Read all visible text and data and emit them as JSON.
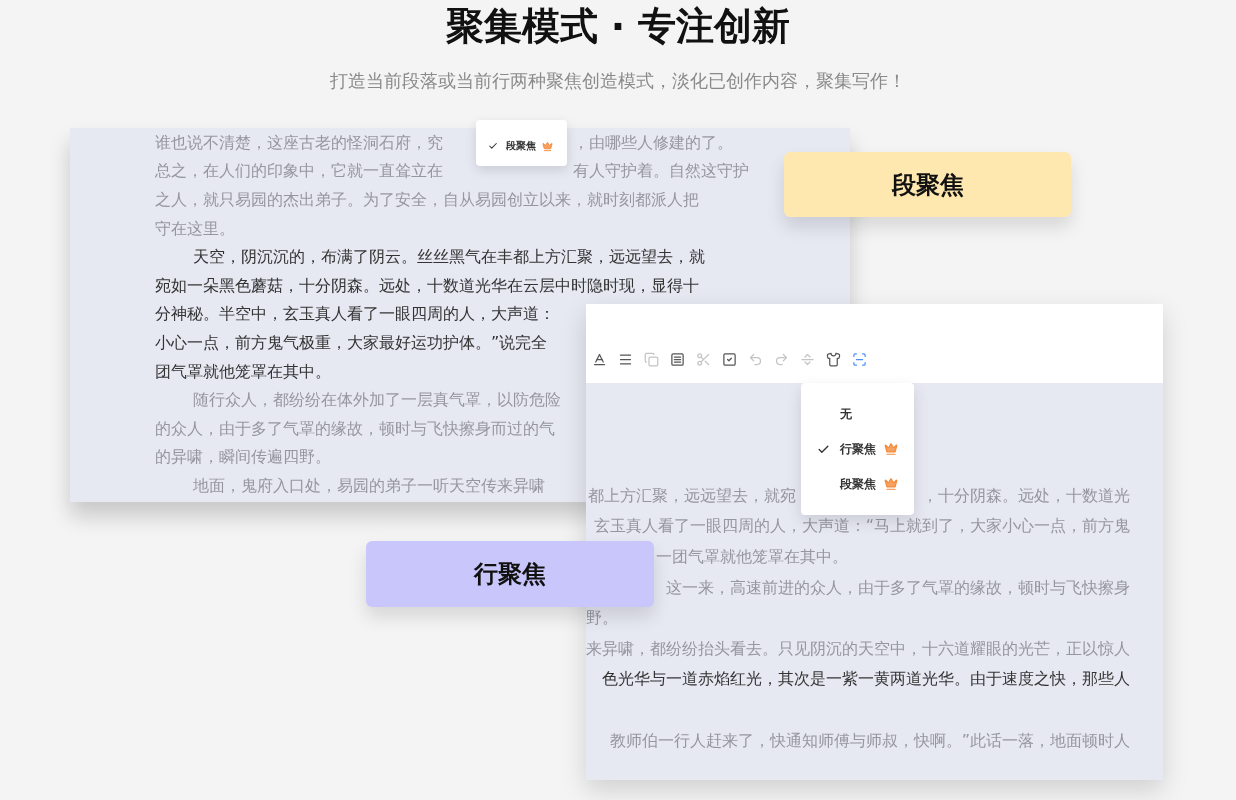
{
  "header": {
    "title": "聚集模式 · 专注创新",
    "subtitle": "打造当前段落或当前行两种聚焦创造模式，淡化已创作内容，聚集写作！"
  },
  "paragraph_card": {
    "lines": [
      {
        "kind": "plain",
        "focus": false,
        "text": "谁也说不清楚，这座古老的怪洞石府，究",
        "after": "，由哪些人修建的了。"
      },
      {
        "kind": "plain",
        "focus": false,
        "text": "总之，在人们的印象中，它就一直耸立在",
        "after": "有人守护着。自然这守护"
      },
      {
        "kind": "plain",
        "focus": false,
        "text": "之人，就只易园的杰出弟子。为了安全，自从易园创立以来，就时刻都派人把"
      },
      {
        "kind": "plain",
        "focus": false,
        "text": "守在这里。"
      },
      {
        "kind": "indent",
        "focus": true,
        "text": "天空，阴沉沉的，布满了阴云。丝丝黑气在丰都上方汇聚，远远望去，就"
      },
      {
        "kind": "plain",
        "focus": true,
        "text": "宛如一朵黑色蘑菇，十分阴森。远处，十数道光华在云层中时隐时现，显得十"
      },
      {
        "kind": "plain",
        "focus": true,
        "text": "分神秘。半空中，玄玉真人看了一眼四周的人，大声道："
      },
      {
        "kind": "plain",
        "focus": true,
        "text": "小心一点，前方鬼气极重，大家最好运功护体。”说完全"
      },
      {
        "kind": "plain",
        "focus": true,
        "text": "团气罩就他笼罩在其中。"
      },
      {
        "kind": "indent",
        "focus": false,
        "text": "随行众人，都纷纷在体外加了一层真气罩，以防危险"
      },
      {
        "kind": "plain",
        "focus": false,
        "text": "的众人，由于多了气罩的缘故，顿时与飞快擦身而过的气"
      },
      {
        "kind": "plain",
        "focus": false,
        "text": "的异啸，瞬间传遍四野。"
      },
      {
        "kind": "indent",
        "focus": false,
        "text": "地面，鬼府入口处，易园的弟子一听天空传来异啸"
      }
    ],
    "menu": [
      {
        "label": "段聚焦",
        "selected": true,
        "premium": true
      }
    ]
  },
  "paragraph_badge": "段聚焦",
  "line_badge": "行聚焦",
  "line_card": {
    "toolbar": [
      {
        "selected": false,
        "disabled": false
      },
      {
        "selected": false,
        "disabled": false
      },
      {
        "selected": false,
        "disabled": true
      },
      {
        "selected": false,
        "disabled": false
      },
      {
        "selected": false,
        "disabled": true
      },
      {
        "selected": false,
        "disabled": false
      },
      {
        "selected": false,
        "disabled": true
      },
      {
        "selected": false,
        "disabled": true
      },
      {
        "selected": false,
        "disabled": true
      },
      {
        "selected": false,
        "disabled": false
      },
      {
        "selected": true,
        "disabled": false
      }
    ],
    "menu": [
      {
        "label": "无",
        "selected": false,
        "premium": false
      },
      {
        "label": "行聚焦",
        "selected": true,
        "premium": true
      },
      {
        "label": "段聚焦",
        "selected": false,
        "premium": true
      }
    ],
    "lines": [
      {
        "kind": "full",
        "focus": false,
        "text": "都上方汇聚，远远望去，就宛",
        "after": "，十分阴森。远处，十数道光"
      },
      {
        "kind": "full",
        "focus": false,
        "text": "玄玉真人看了一眼四周的人，大声道：“马上就到了，大家小心一点，前方鬼"
      },
      {
        "kind": "beside",
        "focus": false,
        "text": "一团气罩就他笼罩在其中。"
      },
      {
        "kind": "full",
        "focus": false,
        "text": "这一来，高速前进的众人，由于多了气罩的缘故，顿时与飞快擦身"
      },
      {
        "kind": "end",
        "focus": false,
        "text": "野。"
      },
      {
        "kind": "full",
        "focus": false,
        "text": "来异啸，都纷纷抬头看去。只见阴沉的天空中，十六道耀眼的光芒，正以惊人"
      },
      {
        "kind": "full",
        "focus": true,
        "text": "色光华与一道赤焰红光，其次是一紫一黄两道光华。由于速度之快，那些人"
      },
      {
        "kind": "blank"
      },
      {
        "kind": "full",
        "focus": false,
        "text": "教师伯一行人赶来了，快通知师傅与师叔，快啊。”此话一落，地面顿时人"
      }
    ]
  }
}
